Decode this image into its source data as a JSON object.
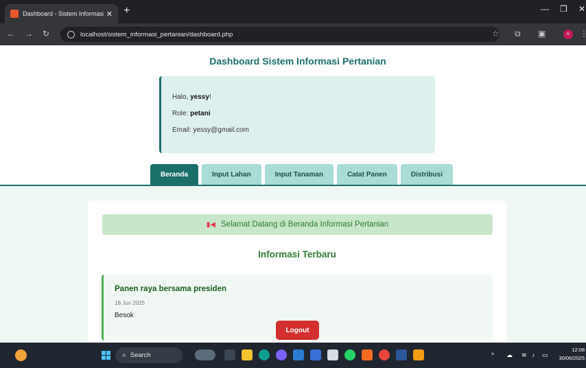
{
  "browser": {
    "tab_title": "Dashboard - Sistem Informasi P",
    "new_tab": "+",
    "url": "localhost/sistem_informasi_pertanian/dashboard.php"
  },
  "page": {
    "title": "Dashboard Sistem Informasi Pertanian",
    "greeting_prefix": "Halo, ",
    "username": "yessy",
    "greeting_suffix": "!",
    "role_label": "Role: ",
    "role": "petani",
    "email_label": "Email: ",
    "email": "yessy@gmail.com"
  },
  "nav": {
    "tabs": [
      {
        "label": "Beranda",
        "active": true
      },
      {
        "label": "Input Lahan",
        "active": false
      },
      {
        "label": "Input Tanaman",
        "active": false
      },
      {
        "label": "Catat Panen",
        "active": false
      },
      {
        "label": "Distribusi",
        "active": false
      }
    ]
  },
  "content": {
    "welcome": "Selamat Datang di Beranda Informasi Pertanian",
    "section_title": "Informasi Terbaru",
    "news": {
      "title": "Panen raya bersama presiden",
      "date": "18 Jun 2025",
      "body": "Besok"
    },
    "logout_label": "Logout"
  },
  "taskbar": {
    "search_placeholder": "Search",
    "time": "12:08",
    "date": "30/06/2025"
  },
  "colors": {
    "primary": "#1b6f6a",
    "tab_inactive": "#a8dcd5",
    "green_text": "#2e7d32",
    "logout": "#d32f2f"
  }
}
